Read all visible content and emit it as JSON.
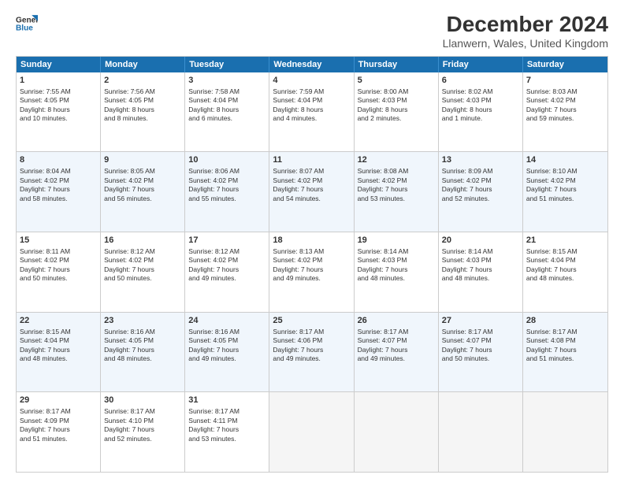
{
  "logo": {
    "line1": "General",
    "line2": "Blue"
  },
  "title": "December 2024",
  "subtitle": "Llanwern, Wales, United Kingdom",
  "header_days": [
    "Sunday",
    "Monday",
    "Tuesday",
    "Wednesday",
    "Thursday",
    "Friday",
    "Saturday"
  ],
  "weeks": [
    [
      {
        "day": "1",
        "lines": [
          "Sunrise: 7:55 AM",
          "Sunset: 4:05 PM",
          "Daylight: 8 hours",
          "and 10 minutes."
        ]
      },
      {
        "day": "2",
        "lines": [
          "Sunrise: 7:56 AM",
          "Sunset: 4:05 PM",
          "Daylight: 8 hours",
          "and 8 minutes."
        ]
      },
      {
        "day": "3",
        "lines": [
          "Sunrise: 7:58 AM",
          "Sunset: 4:04 PM",
          "Daylight: 8 hours",
          "and 6 minutes."
        ]
      },
      {
        "day": "4",
        "lines": [
          "Sunrise: 7:59 AM",
          "Sunset: 4:04 PM",
          "Daylight: 8 hours",
          "and 4 minutes."
        ]
      },
      {
        "day": "5",
        "lines": [
          "Sunrise: 8:00 AM",
          "Sunset: 4:03 PM",
          "Daylight: 8 hours",
          "and 2 minutes."
        ]
      },
      {
        "day": "6",
        "lines": [
          "Sunrise: 8:02 AM",
          "Sunset: 4:03 PM",
          "Daylight: 8 hours",
          "and 1 minute."
        ]
      },
      {
        "day": "7",
        "lines": [
          "Sunrise: 8:03 AM",
          "Sunset: 4:02 PM",
          "Daylight: 7 hours",
          "and 59 minutes."
        ]
      }
    ],
    [
      {
        "day": "8",
        "lines": [
          "Sunrise: 8:04 AM",
          "Sunset: 4:02 PM",
          "Daylight: 7 hours",
          "and 58 minutes."
        ]
      },
      {
        "day": "9",
        "lines": [
          "Sunrise: 8:05 AM",
          "Sunset: 4:02 PM",
          "Daylight: 7 hours",
          "and 56 minutes."
        ]
      },
      {
        "day": "10",
        "lines": [
          "Sunrise: 8:06 AM",
          "Sunset: 4:02 PM",
          "Daylight: 7 hours",
          "and 55 minutes."
        ]
      },
      {
        "day": "11",
        "lines": [
          "Sunrise: 8:07 AM",
          "Sunset: 4:02 PM",
          "Daylight: 7 hours",
          "and 54 minutes."
        ]
      },
      {
        "day": "12",
        "lines": [
          "Sunrise: 8:08 AM",
          "Sunset: 4:02 PM",
          "Daylight: 7 hours",
          "and 53 minutes."
        ]
      },
      {
        "day": "13",
        "lines": [
          "Sunrise: 8:09 AM",
          "Sunset: 4:02 PM",
          "Daylight: 7 hours",
          "and 52 minutes."
        ]
      },
      {
        "day": "14",
        "lines": [
          "Sunrise: 8:10 AM",
          "Sunset: 4:02 PM",
          "Daylight: 7 hours",
          "and 51 minutes."
        ]
      }
    ],
    [
      {
        "day": "15",
        "lines": [
          "Sunrise: 8:11 AM",
          "Sunset: 4:02 PM",
          "Daylight: 7 hours",
          "and 50 minutes."
        ]
      },
      {
        "day": "16",
        "lines": [
          "Sunrise: 8:12 AM",
          "Sunset: 4:02 PM",
          "Daylight: 7 hours",
          "and 50 minutes."
        ]
      },
      {
        "day": "17",
        "lines": [
          "Sunrise: 8:12 AM",
          "Sunset: 4:02 PM",
          "Daylight: 7 hours",
          "and 49 minutes."
        ]
      },
      {
        "day": "18",
        "lines": [
          "Sunrise: 8:13 AM",
          "Sunset: 4:02 PM",
          "Daylight: 7 hours",
          "and 49 minutes."
        ]
      },
      {
        "day": "19",
        "lines": [
          "Sunrise: 8:14 AM",
          "Sunset: 4:03 PM",
          "Daylight: 7 hours",
          "and 48 minutes."
        ]
      },
      {
        "day": "20",
        "lines": [
          "Sunrise: 8:14 AM",
          "Sunset: 4:03 PM",
          "Daylight: 7 hours",
          "and 48 minutes."
        ]
      },
      {
        "day": "21",
        "lines": [
          "Sunrise: 8:15 AM",
          "Sunset: 4:04 PM",
          "Daylight: 7 hours",
          "and 48 minutes."
        ]
      }
    ],
    [
      {
        "day": "22",
        "lines": [
          "Sunrise: 8:15 AM",
          "Sunset: 4:04 PM",
          "Daylight: 7 hours",
          "and 48 minutes."
        ]
      },
      {
        "day": "23",
        "lines": [
          "Sunrise: 8:16 AM",
          "Sunset: 4:05 PM",
          "Daylight: 7 hours",
          "and 48 minutes."
        ]
      },
      {
        "day": "24",
        "lines": [
          "Sunrise: 8:16 AM",
          "Sunset: 4:05 PM",
          "Daylight: 7 hours",
          "and 49 minutes."
        ]
      },
      {
        "day": "25",
        "lines": [
          "Sunrise: 8:17 AM",
          "Sunset: 4:06 PM",
          "Daylight: 7 hours",
          "and 49 minutes."
        ]
      },
      {
        "day": "26",
        "lines": [
          "Sunrise: 8:17 AM",
          "Sunset: 4:07 PM",
          "Daylight: 7 hours",
          "and 49 minutes."
        ]
      },
      {
        "day": "27",
        "lines": [
          "Sunrise: 8:17 AM",
          "Sunset: 4:07 PM",
          "Daylight: 7 hours",
          "and 50 minutes."
        ]
      },
      {
        "day": "28",
        "lines": [
          "Sunrise: 8:17 AM",
          "Sunset: 4:08 PM",
          "Daylight: 7 hours",
          "and 51 minutes."
        ]
      }
    ],
    [
      {
        "day": "29",
        "lines": [
          "Sunrise: 8:17 AM",
          "Sunset: 4:09 PM",
          "Daylight: 7 hours",
          "and 51 minutes."
        ]
      },
      {
        "day": "30",
        "lines": [
          "Sunrise: 8:17 AM",
          "Sunset: 4:10 PM",
          "Daylight: 7 hours",
          "and 52 minutes."
        ]
      },
      {
        "day": "31",
        "lines": [
          "Sunrise: 8:17 AM",
          "Sunset: 4:11 PM",
          "Daylight: 7 hours",
          "and 53 minutes."
        ]
      },
      {
        "day": "",
        "lines": []
      },
      {
        "day": "",
        "lines": []
      },
      {
        "day": "",
        "lines": []
      },
      {
        "day": "",
        "lines": []
      }
    ]
  ]
}
